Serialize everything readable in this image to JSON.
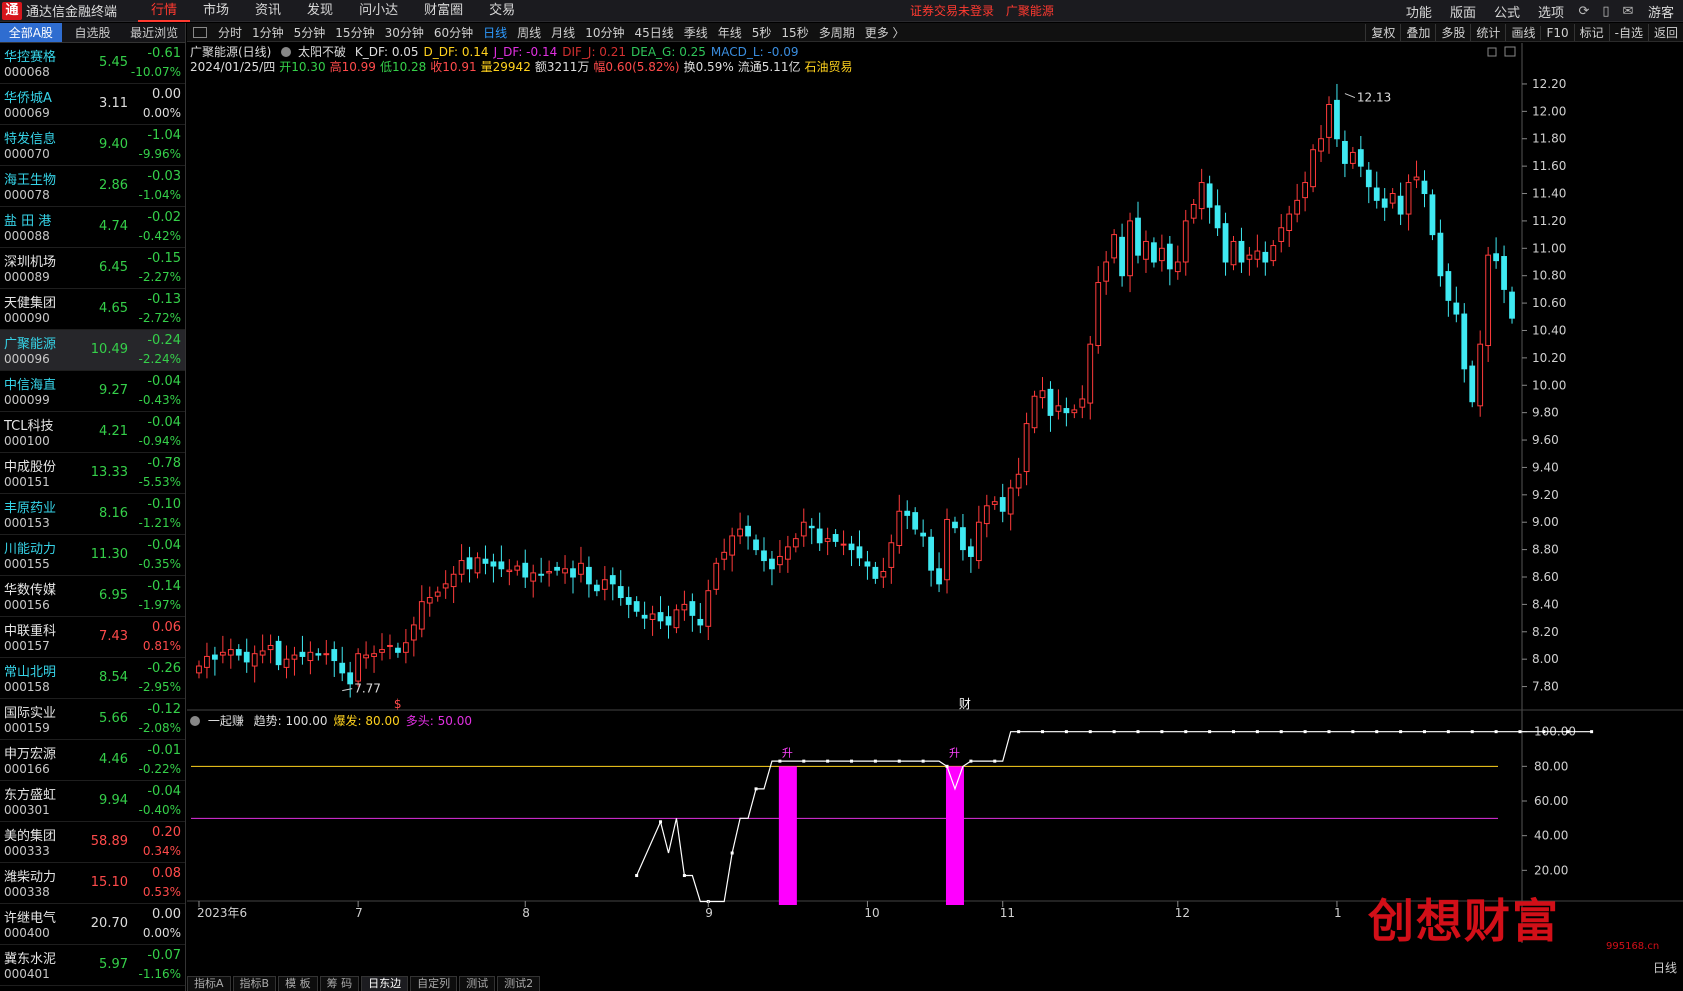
{
  "app": {
    "title": "通达信金融终端",
    "menu": [
      "行情",
      "市场",
      "资讯",
      "发现",
      "问小达",
      "财富圈",
      "交易"
    ],
    "login_status": "证券交易未登录",
    "current_stock": "广聚能源",
    "right_menu": [
      "功能",
      "版面",
      "公式",
      "选项"
    ],
    "guest": "游客",
    "icons": [
      "refresh-icon",
      "phone-icon",
      "mail-icon"
    ]
  },
  "left_panel": {
    "tabs": [
      "全部A股",
      "自选股",
      "最近浏览"
    ],
    "stocks": [
      {
        "name": "华控赛格",
        "code": "000068",
        "price": "5.45",
        "change": "-0.61",
        "pct": "-10.07%",
        "dir": "dn",
        "nc": "cyan"
      },
      {
        "name": "华侨城A",
        "code": "000069",
        "price": "3.11",
        "change": "0.00",
        "pct": "0.00%",
        "dir": "fl",
        "nc": "cyan"
      },
      {
        "name": "特发信息",
        "code": "000070",
        "price": "9.40",
        "change": "-1.04",
        "pct": "-9.96%",
        "dir": "dn",
        "nc": "cyan"
      },
      {
        "name": "海王生物",
        "code": "000078",
        "price": "2.86",
        "change": "-0.03",
        "pct": "-1.04%",
        "dir": "dn",
        "nc": "cyan"
      },
      {
        "name": "盐 田 港",
        "code": "000088",
        "price": "4.74",
        "change": "-0.02",
        "pct": "-0.42%",
        "dir": "dn",
        "nc": "cyan"
      },
      {
        "name": "深圳机场",
        "code": "000089",
        "price": "6.45",
        "change": "-0.15",
        "pct": "-2.27%",
        "dir": "dn",
        "nc": "white"
      },
      {
        "name": "天健集团",
        "code": "000090",
        "price": "4.65",
        "change": "-0.13",
        "pct": "-2.72%",
        "dir": "dn",
        "nc": "white"
      },
      {
        "name": "广聚能源",
        "code": "000096",
        "price": "10.49",
        "change": "-0.24",
        "pct": "-2.24%",
        "dir": "dn",
        "nc": "cyan",
        "sel": true
      },
      {
        "name": "中信海直",
        "code": "000099",
        "price": "9.27",
        "change": "-0.04",
        "pct": "-0.43%",
        "dir": "dn",
        "nc": "cyan"
      },
      {
        "name": "TCL科技",
        "code": "000100",
        "price": "4.21",
        "change": "-0.04",
        "pct": "-0.94%",
        "dir": "dn",
        "nc": "white"
      },
      {
        "name": "中成股份",
        "code": "000151",
        "price": "13.33",
        "change": "-0.78",
        "pct": "-5.53%",
        "dir": "dn",
        "nc": "white"
      },
      {
        "name": "丰原药业",
        "code": "000153",
        "price": "8.16",
        "change": "-0.10",
        "pct": "-1.21%",
        "dir": "dn",
        "nc": "cyan"
      },
      {
        "name": "川能动力",
        "code": "000155",
        "price": "11.30",
        "change": "-0.04",
        "pct": "-0.35%",
        "dir": "dn",
        "nc": "cyan"
      },
      {
        "name": "华数传媒",
        "code": "000156",
        "price": "6.95",
        "change": "-0.14",
        "pct": "-1.97%",
        "dir": "dn",
        "nc": "white"
      },
      {
        "name": "中联重科",
        "code": "000157",
        "price": "7.43",
        "change": "0.06",
        "pct": "0.81%",
        "dir": "up",
        "nc": "white"
      },
      {
        "name": "常山北明",
        "code": "000158",
        "price": "8.54",
        "change": "-0.26",
        "pct": "-2.95%",
        "dir": "dn",
        "nc": "cyan"
      },
      {
        "name": "国际实业",
        "code": "000159",
        "price": "5.66",
        "change": "-0.12",
        "pct": "-2.08%",
        "dir": "dn",
        "nc": "white"
      },
      {
        "name": "申万宏源",
        "code": "000166",
        "price": "4.46",
        "change": "-0.01",
        "pct": "-0.22%",
        "dir": "dn",
        "nc": "white"
      },
      {
        "name": "东方盛虹",
        "code": "000301",
        "price": "9.94",
        "change": "-0.04",
        "pct": "-0.40%",
        "dir": "dn",
        "nc": "white"
      },
      {
        "name": "美的集团",
        "code": "000333",
        "price": "58.89",
        "change": "0.20",
        "pct": "0.34%",
        "dir": "up",
        "nc": "white"
      },
      {
        "name": "潍柴动力",
        "code": "000338",
        "price": "15.10",
        "change": "0.08",
        "pct": "0.53%",
        "dir": "up",
        "nc": "white"
      },
      {
        "name": "许继电气",
        "code": "000400",
        "price": "20.70",
        "change": "0.00",
        "pct": "0.00%",
        "dir": "fl",
        "nc": "white"
      },
      {
        "name": "冀东水泥",
        "code": "000401",
        "price": "5.97",
        "change": "-0.07",
        "pct": "-1.16%",
        "dir": "dn",
        "nc": "white"
      }
    ]
  },
  "period_bar": {
    "periods": [
      "分时",
      "1分钟",
      "5分钟",
      "15分钟",
      "30分钟",
      "60分钟",
      "日线",
      "周线",
      "月线",
      "10分钟",
      "45日线",
      "季线",
      "年线",
      "5秒",
      "15秒",
      "多周期",
      "更多 〉"
    ],
    "active": "日线",
    "tools": [
      "复权",
      "叠加",
      "多股",
      "统计",
      "画线",
      "F10",
      "标记",
      "-自选",
      "返回"
    ]
  },
  "indicator_header": {
    "stock_period": "广聚能源(日线)",
    "formula_name": "太阳不破",
    "values": [
      {
        "text": "K_DF: 0.05",
        "color": "#dddddd"
      },
      {
        "text": "D_DF: 0.14",
        "color": "#ffd21e"
      },
      {
        "text": "J_DF: -0.14",
        "color": "#e030e0"
      },
      {
        "text": "DIF_J: 0.21",
        "color": "#d23030"
      },
      {
        "text": "DEA_G: 0.25",
        "color": "#2fc45a"
      },
      {
        "text": "MACD_L: -0.09",
        "color": "#3a8dde"
      }
    ]
  },
  "quote_line": [
    {
      "text": "2024/01/25/四",
      "color": "#dddddd"
    },
    {
      "text": "开10.30",
      "color": "#35d04a"
    },
    {
      "text": "高10.99",
      "color": "#ff4b4b"
    },
    {
      "text": "低10.28",
      "color": "#35d04a"
    },
    {
      "text": "收10.91",
      "color": "#ff4b4b"
    },
    {
      "text": "量29942",
      "color": "#ffd21e"
    },
    {
      "text": "额3211万",
      "color": "#dddddd"
    },
    {
      "text": "幅0.60(5.82%)",
      "color": "#ff4b4b"
    },
    {
      "text": "换0.59%",
      "color": "#dddddd"
    },
    {
      "text": "流通5.11亿",
      "color": "#dddddd"
    },
    {
      "text": "石油贸易",
      "color": "#ffd21e"
    }
  ],
  "sub_header": {
    "name": "一起赚",
    "values": [
      {
        "text": "趋势: 100.00",
        "color": "#dddddd"
      },
      {
        "text": "爆发: 80.00",
        "color": "#ffd21e"
      },
      {
        "text": "多头: 50.00",
        "color": "#e030e0"
      }
    ]
  },
  "bottom_tabs": [
    "指标A",
    "指标B",
    "模 板",
    "筹 码",
    "日东边",
    "自定列",
    "测试",
    "测试2"
  ],
  "day_label": "日线",
  "watermark": {
    "text": "创想财富",
    "url": "995168.cn"
  },
  "chart_data": {
    "type": "candlestick",
    "title": "广聚能源(日线)",
    "y_ticks": [
      12.2,
      12.0,
      11.8,
      11.6,
      11.4,
      11.2,
      11.0,
      10.8,
      10.6,
      10.4,
      10.2,
      10.0,
      9.8,
      9.6,
      9.4,
      9.2,
      9.0,
      8.8,
      8.6,
      8.4,
      8.2,
      8.0,
      7.8
    ],
    "ylim": [
      7.68,
      12.28
    ],
    "x_labels": [
      {
        "label": "2023年6",
        "idx": 0
      },
      {
        "label": "7",
        "idx": 20
      },
      {
        "label": "8",
        "idx": 41
      },
      {
        "label": "9",
        "idx": 64
      },
      {
        "label": "10",
        "idx": 84
      },
      {
        "label": "11",
        "idx": 101
      },
      {
        "label": "12",
        "idx": 123
      },
      {
        "label": "1",
        "idx": 143
      }
    ],
    "annotations": [
      {
        "text": "12.13",
        "type": "high",
        "idx": 144,
        "value": 12.13
      },
      {
        "text": "7.77",
        "type": "low",
        "idx": 18,
        "value": 7.77
      },
      {
        "text": "$",
        "type": "marker",
        "idx": 25,
        "color": "#ff4b4b"
      },
      {
        "text": "财",
        "type": "marker",
        "idx": 96,
        "color": "#ffffff"
      }
    ],
    "closes": [
      7.95,
      8.02,
      8.0,
      8.05,
      8.07,
      8.03,
      7.98,
      8.04,
      8.06,
      8.1,
      7.96,
      8.0,
      8.03,
      8.02,
      8.05,
      8.03,
      8.04,
      7.99,
      7.9,
      7.82,
      8.04,
      8.03,
      8.04,
      8.07,
      8.1,
      8.05,
      8.12,
      8.25,
      8.42,
      8.45,
      8.49,
      8.55,
      8.62,
      8.72,
      8.66,
      8.74,
      8.7,
      8.68,
      8.66,
      8.65,
      8.68,
      8.6,
      8.63,
      8.62,
      8.64,
      8.65,
      8.66,
      8.6,
      8.7,
      8.55,
      8.5,
      8.58,
      8.55,
      8.45,
      8.4,
      8.35,
      8.3,
      8.33,
      8.28,
      8.25,
      8.36,
      8.4,
      8.32,
      8.25,
      8.5,
      8.7,
      8.78,
      8.9,
      8.95,
      8.9,
      8.8,
      8.72,
      8.66,
      8.75,
      8.82,
      8.88,
      9.0,
      8.96,
      8.85,
      8.88,
      8.86,
      8.84,
      8.8,
      8.74,
      8.68,
      8.59,
      8.64,
      8.85,
      9.08,
      9.05,
      8.95,
      8.9,
      8.65,
      8.55,
      9.02,
      8.96,
      8.8,
      8.75,
      9.0,
      9.12,
      9.15,
      9.08,
      9.25,
      9.35,
      9.72,
      9.92,
      9.96,
      9.78,
      9.85,
      9.8,
      9.82,
      9.9,
      10.3,
      10.75,
      10.9,
      11.1,
      10.8,
      11.2,
      10.95,
      11.05,
      10.9,
      11.0,
      10.85,
      10.9,
      11.2,
      11.32,
      11.48,
      11.3,
      11.15,
      10.9,
      11.05,
      10.9,
      10.95,
      10.98,
      10.9,
      11.02,
      11.15,
      11.25,
      11.35,
      11.48,
      11.72,
      11.8,
      12.05,
      11.8,
      11.62,
      11.7,
      11.6,
      11.45,
      11.35,
      11.3,
      11.4,
      11.25,
      11.48,
      11.52,
      11.4,
      11.1,
      10.8,
      10.62,
      10.52,
      10.12,
      9.88,
      10.3,
      10.95,
      10.91,
      10.7,
      10.49
    ],
    "sub_pane": {
      "ylim": [
        0,
        105
      ],
      "y_ticks": [
        100,
        80,
        60,
        40,
        20
      ],
      "lines": [
        {
          "name": "爆发",
          "value": 80,
          "color": "#ffd21e"
        },
        {
          "name": "多头",
          "value": 50,
          "color": "#e030e0"
        }
      ],
      "trend_start_idx": 55,
      "trend": [
        17,
        null,
        null,
        48,
        30,
        50,
        17,
        17,
        2,
        2,
        2,
        2,
        30,
        50,
        50,
        67,
        67,
        83,
        83,
        83,
        83,
        83,
        83,
        83,
        83,
        83,
        83,
        83,
        83,
        83,
        83,
        83,
        83,
        83,
        83,
        83,
        83,
        83,
        83,
        80,
        67,
        80,
        83,
        83,
        83,
        83,
        83,
        100,
        100,
        100,
        100,
        100,
        100,
        100,
        100,
        100,
        100,
        100,
        100,
        100,
        100,
        100,
        100,
        100,
        100,
        100,
        100,
        100,
        100,
        100,
        100,
        100,
        100,
        100,
        100,
        100,
        100,
        100,
        100,
        100,
        100,
        100,
        100,
        100,
        100,
        100,
        100,
        100,
        100,
        100,
        100,
        100,
        100,
        100,
        100,
        100,
        100,
        100,
        100,
        100,
        100,
        100,
        100,
        100,
        100,
        100,
        100,
        100,
        100,
        100,
        100,
        100,
        100,
        100,
        100,
        100,
        100,
        100,
        100,
        100,
        100
      ],
      "signals": [
        {
          "label": "升",
          "idx": 74,
          "from": 0,
          "to": 80
        },
        {
          "label": "升",
          "idx": 95,
          "from": 0,
          "to": 80
        }
      ]
    }
  }
}
